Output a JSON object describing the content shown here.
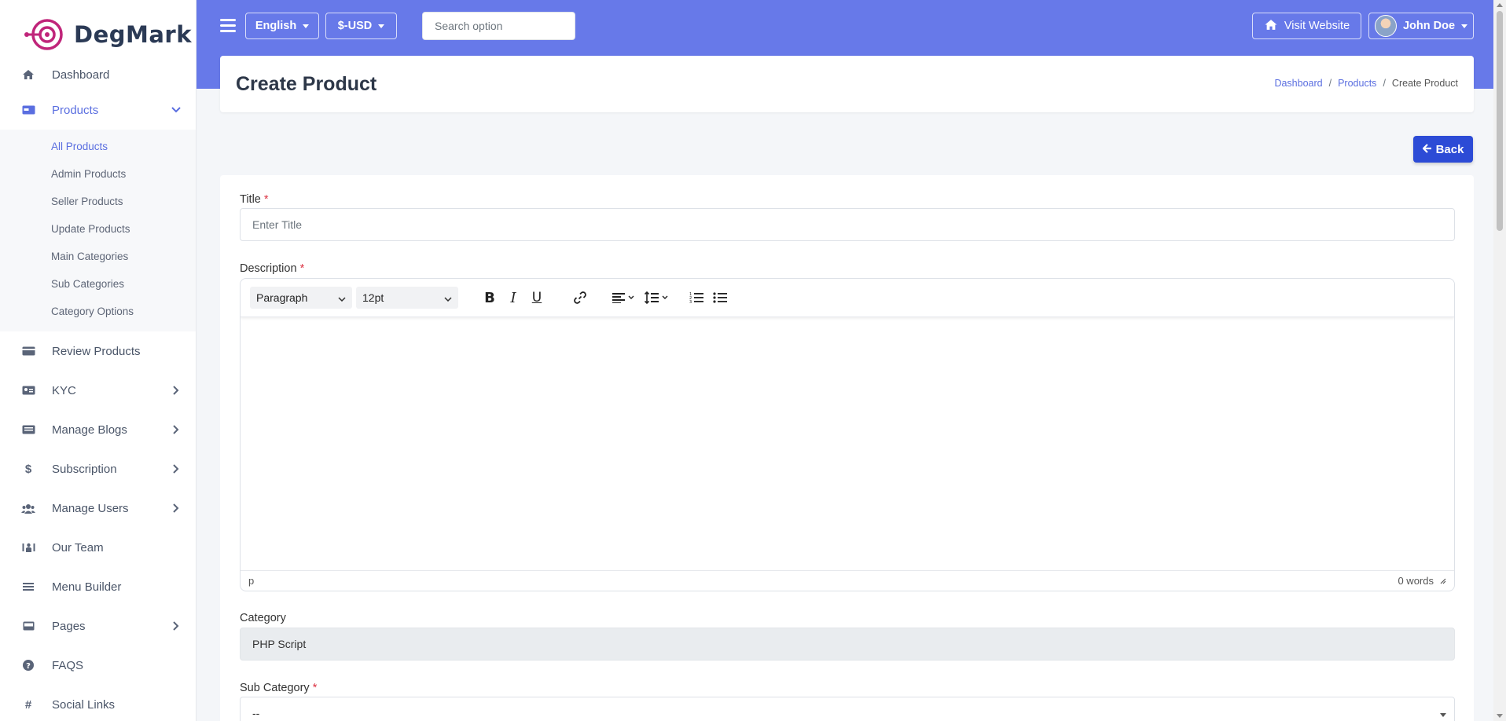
{
  "brand": {
    "name": "DegMark",
    "accent": "#c0257a"
  },
  "sidebar": {
    "items": [
      {
        "label": "Dashboard",
        "icon": "home-icon"
      },
      {
        "label": "Products",
        "icon": "product-card-icon",
        "expanded": true
      },
      {
        "label": "Review Products",
        "icon": "review-card-icon"
      },
      {
        "label": "KYC",
        "icon": "id-card-icon"
      },
      {
        "label": "Manage Blogs",
        "icon": "blog-icon"
      },
      {
        "label": "Subscription",
        "icon": "dollar-icon"
      },
      {
        "label": "Manage Users",
        "icon": "users-icon"
      },
      {
        "label": "Our Team",
        "icon": "team-icon"
      },
      {
        "label": "Menu Builder",
        "icon": "menu-lines-icon"
      },
      {
        "label": "Pages",
        "icon": "pages-icon"
      },
      {
        "label": "FAQS",
        "icon": "question-icon"
      },
      {
        "label": "Social Links",
        "icon": "hash-icon"
      }
    ],
    "products_sub": [
      "All Products",
      "Admin Products",
      "Seller Products",
      "Update Products",
      "Main Categories",
      "Sub Categories",
      "Category Options"
    ]
  },
  "header": {
    "language": "English",
    "currency": "$-USD",
    "search_placeholder": "Search option",
    "visit_website": "Visit Website",
    "user_name": "John Doe",
    "bg_color": "#6779e9"
  },
  "page": {
    "title": "Create Product",
    "breadcrumb": [
      "Dashboard",
      "Products",
      "Create Product"
    ],
    "back_label": "Back"
  },
  "form": {
    "title_label": "Title",
    "title_placeholder": "Enter Title",
    "description_label": "Description",
    "editor": {
      "block_format": "Paragraph",
      "font_size": "12pt",
      "path": "p",
      "word_count": "0 words"
    },
    "category_label": "Category",
    "category_value": "PHP Script",
    "subcategory_label": "Sub Category",
    "subcategory_value": "--",
    "required_mark": "*"
  }
}
